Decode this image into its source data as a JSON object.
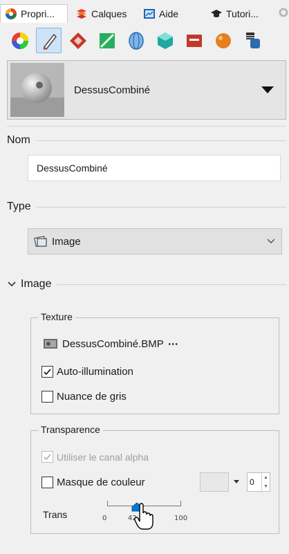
{
  "tabs": [
    {
      "label": "Propri...",
      "icon": "properties-icon",
      "active": true
    },
    {
      "label": "Calques",
      "icon": "layers-icon",
      "active": false
    },
    {
      "label": "Aide",
      "icon": "help-icon",
      "active": false
    },
    {
      "label": "Tutori...",
      "icon": "tutorial-icon",
      "active": false
    }
  ],
  "toolbar": {
    "icons": [
      "color-wheel-icon",
      "brush-edit-icon",
      "texture-mapping-icon",
      "decal-icon",
      "shape-icon",
      "environment-icon",
      "render-icon",
      "sphere-material-icon",
      "stack-icon"
    ],
    "active_index": 1
  },
  "material": {
    "name": "DessusCombiné",
    "thumb_icon": "material-preview-icon"
  },
  "sections": {
    "name": {
      "title": "Nom",
      "value": "DessusCombiné"
    },
    "type": {
      "title": "Type",
      "value": "Image"
    },
    "image": {
      "title": "Image",
      "expanded": true
    }
  },
  "texture": {
    "title": "Texture",
    "file": "DessusCombiné.BMP",
    "more": "⋯",
    "auto_illumination": {
      "label": "Auto-illumination",
      "checked": true
    },
    "grayscale": {
      "label": "Nuance de gris",
      "checked": false
    }
  },
  "transparency": {
    "title": "Transparence",
    "alpha": {
      "label": "Utiliser le canal alpha",
      "checked": true,
      "disabled": true
    },
    "color_mask": {
      "label": "Masque de couleur",
      "checked": false
    },
    "spin_value": "0",
    "trans_label": "Trans",
    "slider": {
      "min": "0",
      "value": "42",
      "max": "100"
    }
  },
  "colors": {
    "accent": "#0078d7",
    "selected_bg": "#cfe3f7"
  }
}
